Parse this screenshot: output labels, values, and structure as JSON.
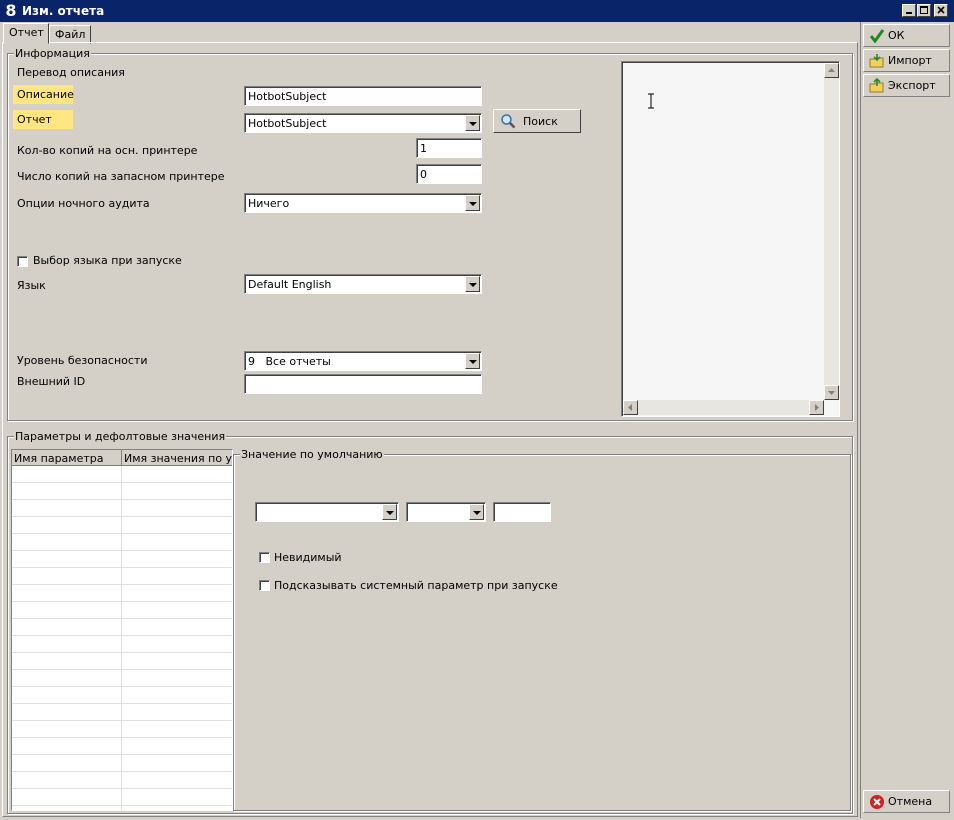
{
  "window": {
    "title": "Изм. отчета",
    "logo": "8"
  },
  "tabs": [
    {
      "label": "Отчет",
      "active": true
    },
    {
      "label": "Файл",
      "active": false
    }
  ],
  "info_group": {
    "legend": "Информация",
    "translate_label": "Перевод описания",
    "description": {
      "label": "Описание",
      "value": "HotbotSubject"
    },
    "report": {
      "label": "Отчет",
      "value": "HotbotSubject"
    },
    "search_button": "Поиск",
    "copies_main": {
      "label": "Кол-во копий на осн. принтере",
      "value": "1"
    },
    "copies_backup": {
      "label": "Число копий на запасном принтере",
      "value": "0"
    },
    "night_audit": {
      "label": "Опции ночного аудита",
      "value": "Ничего"
    },
    "lang_select_checkbox": {
      "label": "Выбор языка при запуске",
      "checked": false
    },
    "language": {
      "label": "Язык",
      "value": "Default English"
    },
    "security": {
      "label": "Уровень безопасности",
      "value": "9   Все отчеты"
    },
    "external_id": {
      "label": "Внешний ID",
      "value": ""
    }
  },
  "params_group": {
    "legend": "Параметры и дефолтовые значения",
    "columns": [
      "Имя параметра",
      "Имя значения по умолчанию"
    ],
    "default_value_legend": "Значение по умолчанию",
    "combo1": "",
    "combo2": "",
    "text1": "",
    "invisible": {
      "label": "Невидимый",
      "checked": false
    },
    "prompt_param": {
      "label": "Подсказывать системный параметр при запуске",
      "checked": false
    }
  },
  "side_buttons": {
    "ok": "ОК",
    "import": "Импорт",
    "export": "Экспорт",
    "cancel": "Отмена"
  },
  "colors": {
    "title_bar": "#0a246a",
    "highlight": "#ffe680",
    "ok_icon": "#1e8a1e",
    "cancel_icon": "#d22020"
  }
}
